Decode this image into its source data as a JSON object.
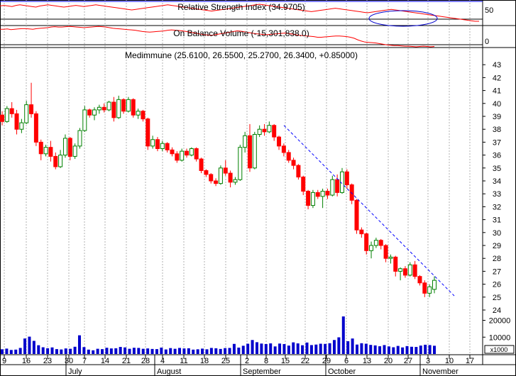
{
  "chart_data": [
    {
      "type": "line",
      "title": "Relative Strength Index (34.9705)",
      "y_ticks": [
        50
      ],
      "series_color": "#ff0000",
      "values": [
        62,
        63,
        62,
        61,
        63,
        64,
        63,
        62,
        61,
        60,
        62,
        63,
        64,
        63,
        62,
        61,
        60,
        61,
        62,
        63,
        62,
        61,
        62,
        63,
        64,
        63,
        62,
        61,
        60,
        59,
        58,
        57,
        56,
        55,
        56,
        57,
        58,
        59,
        60,
        61,
        62,
        63,
        64,
        63,
        62,
        61,
        60,
        59,
        58,
        57,
        56,
        55,
        54,
        53,
        54,
        55,
        56,
        57,
        58,
        59,
        60,
        61,
        62,
        63,
        64,
        65,
        64,
        63,
        62,
        61,
        60,
        59,
        58,
        57,
        56,
        55,
        54,
        53,
        52,
        53,
        54,
        55,
        56,
        57,
        58,
        57,
        56,
        55,
        54,
        53,
        52,
        51,
        50,
        51,
        52,
        53,
        54,
        55,
        56,
        55,
        54,
        53,
        52,
        51,
        50,
        49,
        48,
        47,
        46,
        45,
        44,
        43,
        42,
        41,
        40,
        39,
        38,
        37,
        36,
        35,
        35
      ]
    },
    {
      "type": "line",
      "title": "On Balance Volume (-15,301,838.0)",
      "y_ticks": [
        0
      ],
      "series_color": "#ff0000",
      "values": [
        0.55,
        0.55,
        0.56,
        0.54,
        0.55,
        0.56,
        0.57,
        0.57,
        0.56,
        0.55,
        0.57,
        0.58,
        0.59,
        0.6,
        0.62,
        0.63,
        0.62,
        0.62,
        0.63,
        0.64,
        0.63,
        0.62,
        0.61,
        0.6,
        0.61,
        0.62,
        0.63,
        0.64,
        0.63,
        0.62,
        0.6,
        0.58,
        0.57,
        0.56,
        0.55,
        0.54,
        0.53,
        0.52,
        0.5,
        0.48,
        0.47,
        0.46,
        0.47,
        0.48,
        0.49,
        0.5,
        0.52,
        0.53,
        0.52,
        0.51,
        0.5,
        0.48,
        0.46,
        0.44,
        0.42,
        0.4,
        0.38,
        0.37,
        0.36,
        0.38,
        0.4,
        0.42,
        0.44,
        0.46,
        0.48,
        0.5,
        0.49,
        0.47,
        0.45,
        0.43,
        0.41,
        0.4,
        0.39,
        0.38,
        0.39,
        0.4,
        0.41,
        0.42,
        0.43,
        0.42,
        0.4,
        0.38,
        0.36,
        0.35,
        0.34,
        0.33,
        0.32,
        0.3,
        0.3,
        0.31,
        0.32,
        0.33,
        0.34,
        0.34,
        0.33,
        0.32,
        0.3,
        0.27,
        0.22,
        0.18,
        0.15,
        0.14,
        0.13,
        0.12,
        0.1,
        0.08,
        0.06,
        0.05,
        0.04,
        0.04,
        0.03,
        0.02,
        0.02,
        0.01,
        0,
        0.01,
        0.02,
        0.01,
        0,
        0.01
      ]
    },
    {
      "type": "candlestick",
      "title": "Medimmune (25.6100, 26.5500, 25.2700, 26.3400, +0.85000)",
      "ylim": [
        24,
        43
      ],
      "y_ticks": [
        24,
        25,
        26,
        27,
        28,
        29,
        30,
        31,
        32,
        33,
        34,
        35,
        36,
        37,
        38,
        39,
        40,
        41,
        42,
        43
      ],
      "x_tick_labels": [
        "9",
        "16",
        "23",
        "30",
        "7",
        "14",
        "21",
        "28",
        "4",
        "11",
        "18",
        "25",
        "2",
        "8",
        "15",
        "22",
        "29",
        "6",
        "13",
        "20",
        "27",
        "3",
        "10",
        "17"
      ],
      "month_labels": [
        "July",
        "August",
        "September",
        "October",
        "November"
      ],
      "up_color": "#008000",
      "down_color": "#ff0000",
      "trendline": {
        "from": {
          "date": "Sep 15",
          "value": 38.3
        },
        "to": {
          "date": "Nov 7",
          "value": 25.1
        },
        "color": "#0000ff"
      },
      "ohlc": [
        [
          39.1,
          39.4,
          38.3,
          38.6
        ],
        [
          38.6,
          39.8,
          38.5,
          39.6
        ],
        [
          39.6,
          40.1,
          38.9,
          39.2
        ],
        [
          39.2,
          39.5,
          37.6,
          38.0
        ],
        [
          38.0,
          38.8,
          37.7,
          38.5
        ],
        [
          38.5,
          40.2,
          38.4,
          39.9
        ],
        [
          39.9,
          41.6,
          38.9,
          39.2
        ],
        [
          39.2,
          39.4,
          36.7,
          37.0
        ],
        [
          37.0,
          37.2,
          35.6,
          36.1
        ],
        [
          36.1,
          36.8,
          35.9,
          36.6
        ],
        [
          36.6,
          37.1,
          35.5,
          35.9
        ],
        [
          35.9,
          36.2,
          34.9,
          35.1
        ],
        [
          35.1,
          36.4,
          35.0,
          36.0
        ],
        [
          36.0,
          37.6,
          35.8,
          37.3
        ],
        [
          37.3,
          37.4,
          35.6,
          35.9
        ],
        [
          35.9,
          36.9,
          35.7,
          36.7
        ],
        [
          36.7,
          38.1,
          36.5,
          37.9
        ],
        [
          37.9,
          39.8,
          37.8,
          39.5
        ],
        [
          39.5,
          39.6,
          38.9,
          39.1
        ],
        [
          39.1,
          39.7,
          38.7,
          39.5
        ],
        [
          39.5,
          39.9,
          39.2,
          39.7
        ],
        [
          39.7,
          40.0,
          39.3,
          39.5
        ],
        [
          39.5,
          40.2,
          39.4,
          40.1
        ],
        [
          40.1,
          40.5,
          38.6,
          38.9
        ],
        [
          38.9,
          40.6,
          38.8,
          40.3
        ],
        [
          40.3,
          40.4,
          39.2,
          39.4
        ],
        [
          39.4,
          40.5,
          39.3,
          40.3
        ],
        [
          40.3,
          40.4,
          38.9,
          39.1
        ],
        [
          39.1,
          39.6,
          38.8,
          39.4
        ],
        [
          39.4,
          39.5,
          38.6,
          38.8
        ],
        [
          38.8,
          38.9,
          36.4,
          36.7
        ],
        [
          36.7,
          37.5,
          36.5,
          37.2
        ],
        [
          37.2,
          37.4,
          36.3,
          36.5
        ],
        [
          36.5,
          37.1,
          36.3,
          36.9
        ],
        [
          36.9,
          37.0,
          36.2,
          36.4
        ],
        [
          36.4,
          36.6,
          35.9,
          36.1
        ],
        [
          36.1,
          36.3,
          35.4,
          35.6
        ],
        [
          35.6,
          36.5,
          35.5,
          36.3
        ],
        [
          36.3,
          36.5,
          35.8,
          36.0
        ],
        [
          36.0,
          36.6,
          35.9,
          36.5
        ],
        [
          36.5,
          36.6,
          35.5,
          35.7
        ],
        [
          35.7,
          35.8,
          34.6,
          34.8
        ],
        [
          34.8,
          34.9,
          34.3,
          34.5
        ],
        [
          34.5,
          34.6,
          33.8,
          34.0
        ],
        [
          34.0,
          34.2,
          33.6,
          33.8
        ],
        [
          33.8,
          35.2,
          33.7,
          35.0
        ],
        [
          35.0,
          35.6,
          34.4,
          34.6
        ],
        [
          34.6,
          34.8,
          33.5,
          33.9
        ],
        [
          33.9,
          34.3,
          33.7,
          34.1
        ],
        [
          34.1,
          36.8,
          34.0,
          36.6
        ],
        [
          36.6,
          37.8,
          36.2,
          37.5
        ],
        [
          37.5,
          38.4,
          34.7,
          35.0
        ],
        [
          35.0,
          37.8,
          34.9,
          37.6
        ],
        [
          37.6,
          38.3,
          37.4,
          38.0
        ],
        [
          38.0,
          38.4,
          37.5,
          37.8
        ],
        [
          37.8,
          38.6,
          37.7,
          38.3
        ],
        [
          38.3,
          38.4,
          37.1,
          37.4
        ],
        [
          37.4,
          37.5,
          36.4,
          36.7
        ],
        [
          36.7,
          36.9,
          35.9,
          36.2
        ],
        [
          36.2,
          36.4,
          35.4,
          35.6
        ],
        [
          35.6,
          35.8,
          34.9,
          35.2
        ],
        [
          35.2,
          35.3,
          34.1,
          34.3
        ],
        [
          34.3,
          34.4,
          32.9,
          33.2
        ],
        [
          33.2,
          33.3,
          31.8,
          32.1
        ],
        [
          32.1,
          33.3,
          31.9,
          33.1
        ],
        [
          33.1,
          33.3,
          32.6,
          32.8
        ],
        [
          32.8,
          33.4,
          31.9,
          33.2
        ],
        [
          33.2,
          33.4,
          32.6,
          32.9
        ],
        [
          32.9,
          34.4,
          32.8,
          34.1
        ],
        [
          34.1,
          34.5,
          32.8,
          33.1
        ],
        [
          33.1,
          35.0,
          33.0,
          34.7
        ],
        [
          34.7,
          34.9,
          33.4,
          33.7
        ],
        [
          33.7,
          33.8,
          32.2,
          32.5
        ],
        [
          32.5,
          32.6,
          29.9,
          30.2
        ],
        [
          30.2,
          30.4,
          29.6,
          29.9
        ],
        [
          29.9,
          30.0,
          28.3,
          28.6
        ],
        [
          28.6,
          29.3,
          28.0,
          29.0
        ],
        [
          29.0,
          29.6,
          28.8,
          29.4
        ],
        [
          29.4,
          29.5,
          28.7,
          29.0
        ],
        [
          29.0,
          29.1,
          27.7,
          28.0
        ],
        [
          28.0,
          28.3,
          27.6,
          28.1
        ],
        [
          28.1,
          28.2,
          26.6,
          27.0
        ],
        [
          27.0,
          27.3,
          26.3,
          27.2
        ],
        [
          27.2,
          27.4,
          26.5,
          26.7
        ],
        [
          26.7,
          27.7,
          26.6,
          27.5
        ],
        [
          27.5,
          27.8,
          26.4,
          26.6
        ],
        [
          26.6,
          26.7,
          25.9,
          26.1
        ],
        [
          26.1,
          26.3,
          25.0,
          25.3
        ],
        [
          25.3,
          26.0,
          25.0,
          25.8
        ],
        [
          25.6,
          26.6,
          25.3,
          26.3
        ]
      ]
    },
    {
      "type": "bar",
      "title": "Volume",
      "units_label": "x1000",
      "y_ticks": [
        10000,
        20000
      ],
      "ylim": [
        0,
        24000
      ],
      "bar_color": "#0000cc",
      "values": [
        2800,
        3200,
        2400,
        2600,
        3600,
        9200,
        10300,
        7800,
        5200,
        4000,
        3400,
        3900,
        2900,
        2700,
        3300,
        3100,
        4300,
        11100,
        4100,
        2600,
        2200,
        3100,
        2900,
        3700,
        3300,
        3400,
        4200,
        3900,
        3100,
        3700,
        3600,
        3100,
        3300,
        3000,
        2900,
        3800,
        2700,
        3500,
        3100,
        3600,
        3300,
        3400,
        2600,
        2800,
        3200,
        2800,
        3600,
        3400,
        3000,
        3500,
        3600,
        6000,
        3800,
        4900,
        6100,
        8300,
        7000,
        6200,
        5900,
        6300,
        4500,
        6200,
        5900,
        5000,
        6900,
        6300,
        5200,
        6800,
        5300,
        5600,
        6100,
        6000,
        6400,
        8300,
        9900,
        22300,
        7600,
        9200,
        5600,
        6400,
        6100,
        5400,
        5100,
        4600,
        5300,
        4500,
        4000,
        4800,
        3900,
        4700,
        4300,
        4200,
        5000,
        5500,
        5300,
        4900
      ]
    }
  ]
}
